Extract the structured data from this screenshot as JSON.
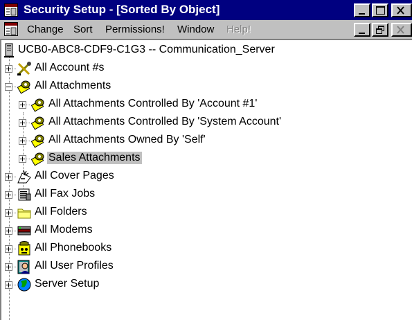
{
  "window": {
    "title": "Security Setup - [Sorted By Object]"
  },
  "menu": {
    "items": [
      {
        "label": "Change",
        "enabled": true
      },
      {
        "label": "Sort",
        "enabled": true
      },
      {
        "label": "Permissions!",
        "enabled": true
      },
      {
        "label": "Window",
        "enabled": true
      },
      {
        "label": "Help!",
        "enabled": false
      }
    ]
  },
  "tree": {
    "root": {
      "label": "UCB0-ABC8-CDF9-C1G3 -- Communication_Server",
      "icon": "server-icon"
    },
    "nodes": [
      {
        "label": "All Account #s",
        "icon": "tools-icon",
        "expanded": false
      },
      {
        "label": "All Attachments",
        "icon": "attachment-icon",
        "expanded": true,
        "children": [
          {
            "label": "All Attachments Controlled By 'Account #1'",
            "icon": "attachment-icon"
          },
          {
            "label": "All Attachments Controlled By 'System Account'",
            "icon": "attachment-icon"
          },
          {
            "label": "All Attachments Owned By 'Self'",
            "icon": "attachment-icon"
          },
          {
            "label": "Sales Attachments",
            "icon": "attachment-icon",
            "selected": true
          }
        ]
      },
      {
        "label": "All Cover Pages",
        "icon": "cover-page-icon",
        "expanded": false
      },
      {
        "label": "All Fax Jobs",
        "icon": "fax-job-icon",
        "expanded": false
      },
      {
        "label": "All Folders",
        "icon": "folder-icon",
        "expanded": false
      },
      {
        "label": "All Modems",
        "icon": "modem-icon",
        "expanded": false
      },
      {
        "label": "All Phonebooks",
        "icon": "phonebook-icon",
        "expanded": false
      },
      {
        "label": "All User Profiles",
        "icon": "user-profile-icon",
        "expanded": false
      },
      {
        "label": "Server Setup",
        "icon": "globe-icon",
        "expanded": false
      }
    ]
  }
}
